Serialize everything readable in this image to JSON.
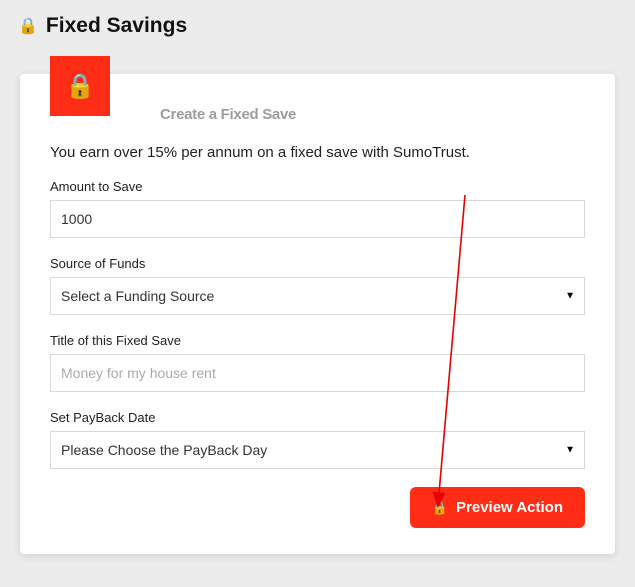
{
  "header": {
    "title": "Fixed Savings"
  },
  "card": {
    "title": "Create a Fixed Save",
    "intro": "You earn over 15% per annum on a fixed save with SumoTrust."
  },
  "fields": {
    "amount": {
      "label": "Amount to Save",
      "value": "1000"
    },
    "source": {
      "label": "Source of Funds",
      "selected": "Select a Funding Source"
    },
    "title": {
      "label": "Title of this Fixed Save",
      "placeholder": "Money for my house rent",
      "value": ""
    },
    "payback": {
      "label": "Set PayBack Date",
      "selected": "Please Choose the PayBack Day"
    }
  },
  "actions": {
    "preview": "Preview Action"
  },
  "icons": {
    "lock": "🔒"
  },
  "colors": {
    "accent": "#ff2d16"
  }
}
